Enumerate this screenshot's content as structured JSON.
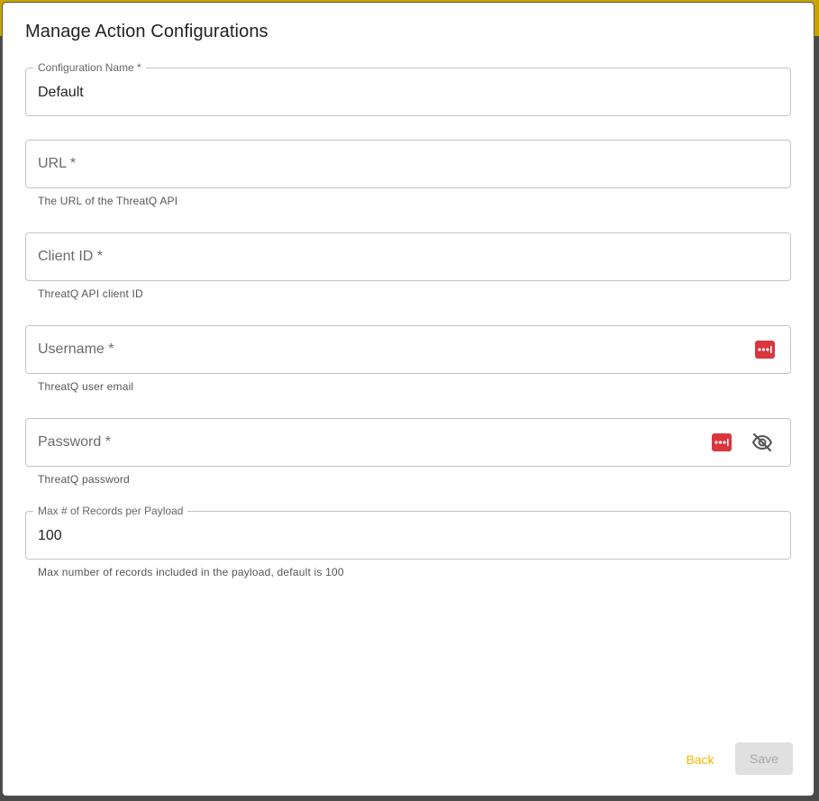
{
  "dialog": {
    "title": "Manage Action Configurations"
  },
  "fields": {
    "config_name": {
      "label": "Configuration Name *",
      "value": "Default"
    },
    "url": {
      "placeholder": "URL *",
      "helper": "The URL of the ThreatQ API"
    },
    "client_id": {
      "placeholder": "Client ID *",
      "helper": "ThreatQ API client ID"
    },
    "username": {
      "placeholder": "Username *",
      "helper": "ThreatQ user email"
    },
    "password": {
      "placeholder": "Password *",
      "helper": "ThreatQ password"
    },
    "max_records": {
      "label": "Max # of Records per Payload",
      "value": "100",
      "helper": "Max number of records included in the payload, default is 100"
    }
  },
  "actions": {
    "back_label": "Back",
    "save_label": "Save"
  },
  "icons": {
    "password_manager": "keeper-autofill-icon",
    "visibility_toggle": "eye-off-icon"
  },
  "colors": {
    "accent": "#f2b600",
    "password_manager_icon": "#d9363e",
    "save_disabled_bg": "#e0e0e0"
  }
}
